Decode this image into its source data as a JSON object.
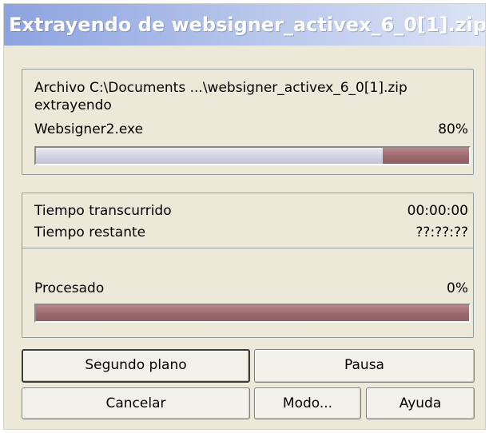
{
  "window": {
    "title": "Extrayendo de websigner_activex_6_0[1].zip"
  },
  "file_group": {
    "archive_line": "Archivo C:\\Documents ...\\websigner_activex_6_0[1].zip",
    "status": "extrayendo",
    "current_file": "Websigner2.exe",
    "percent_text": "80%",
    "progress": 0.8
  },
  "time_group": {
    "elapsed_label": "Tiempo transcurrido",
    "elapsed_value": "00:00:00",
    "remaining_label": "Tiempo restante",
    "remaining_value": "??:??:??",
    "processed_label": "Procesado",
    "processed_percent_text": "0%",
    "progress": 0.0
  },
  "buttons": {
    "background": "Segundo plano",
    "pause": "Pausa",
    "cancel": "Cancelar",
    "mode": "Modo...",
    "help": "Ayuda"
  },
  "colors": {
    "progress_fill": "#9c6a6f",
    "progress_track": "#d7d6e6",
    "dialog_bg": "#ece9d8"
  }
}
